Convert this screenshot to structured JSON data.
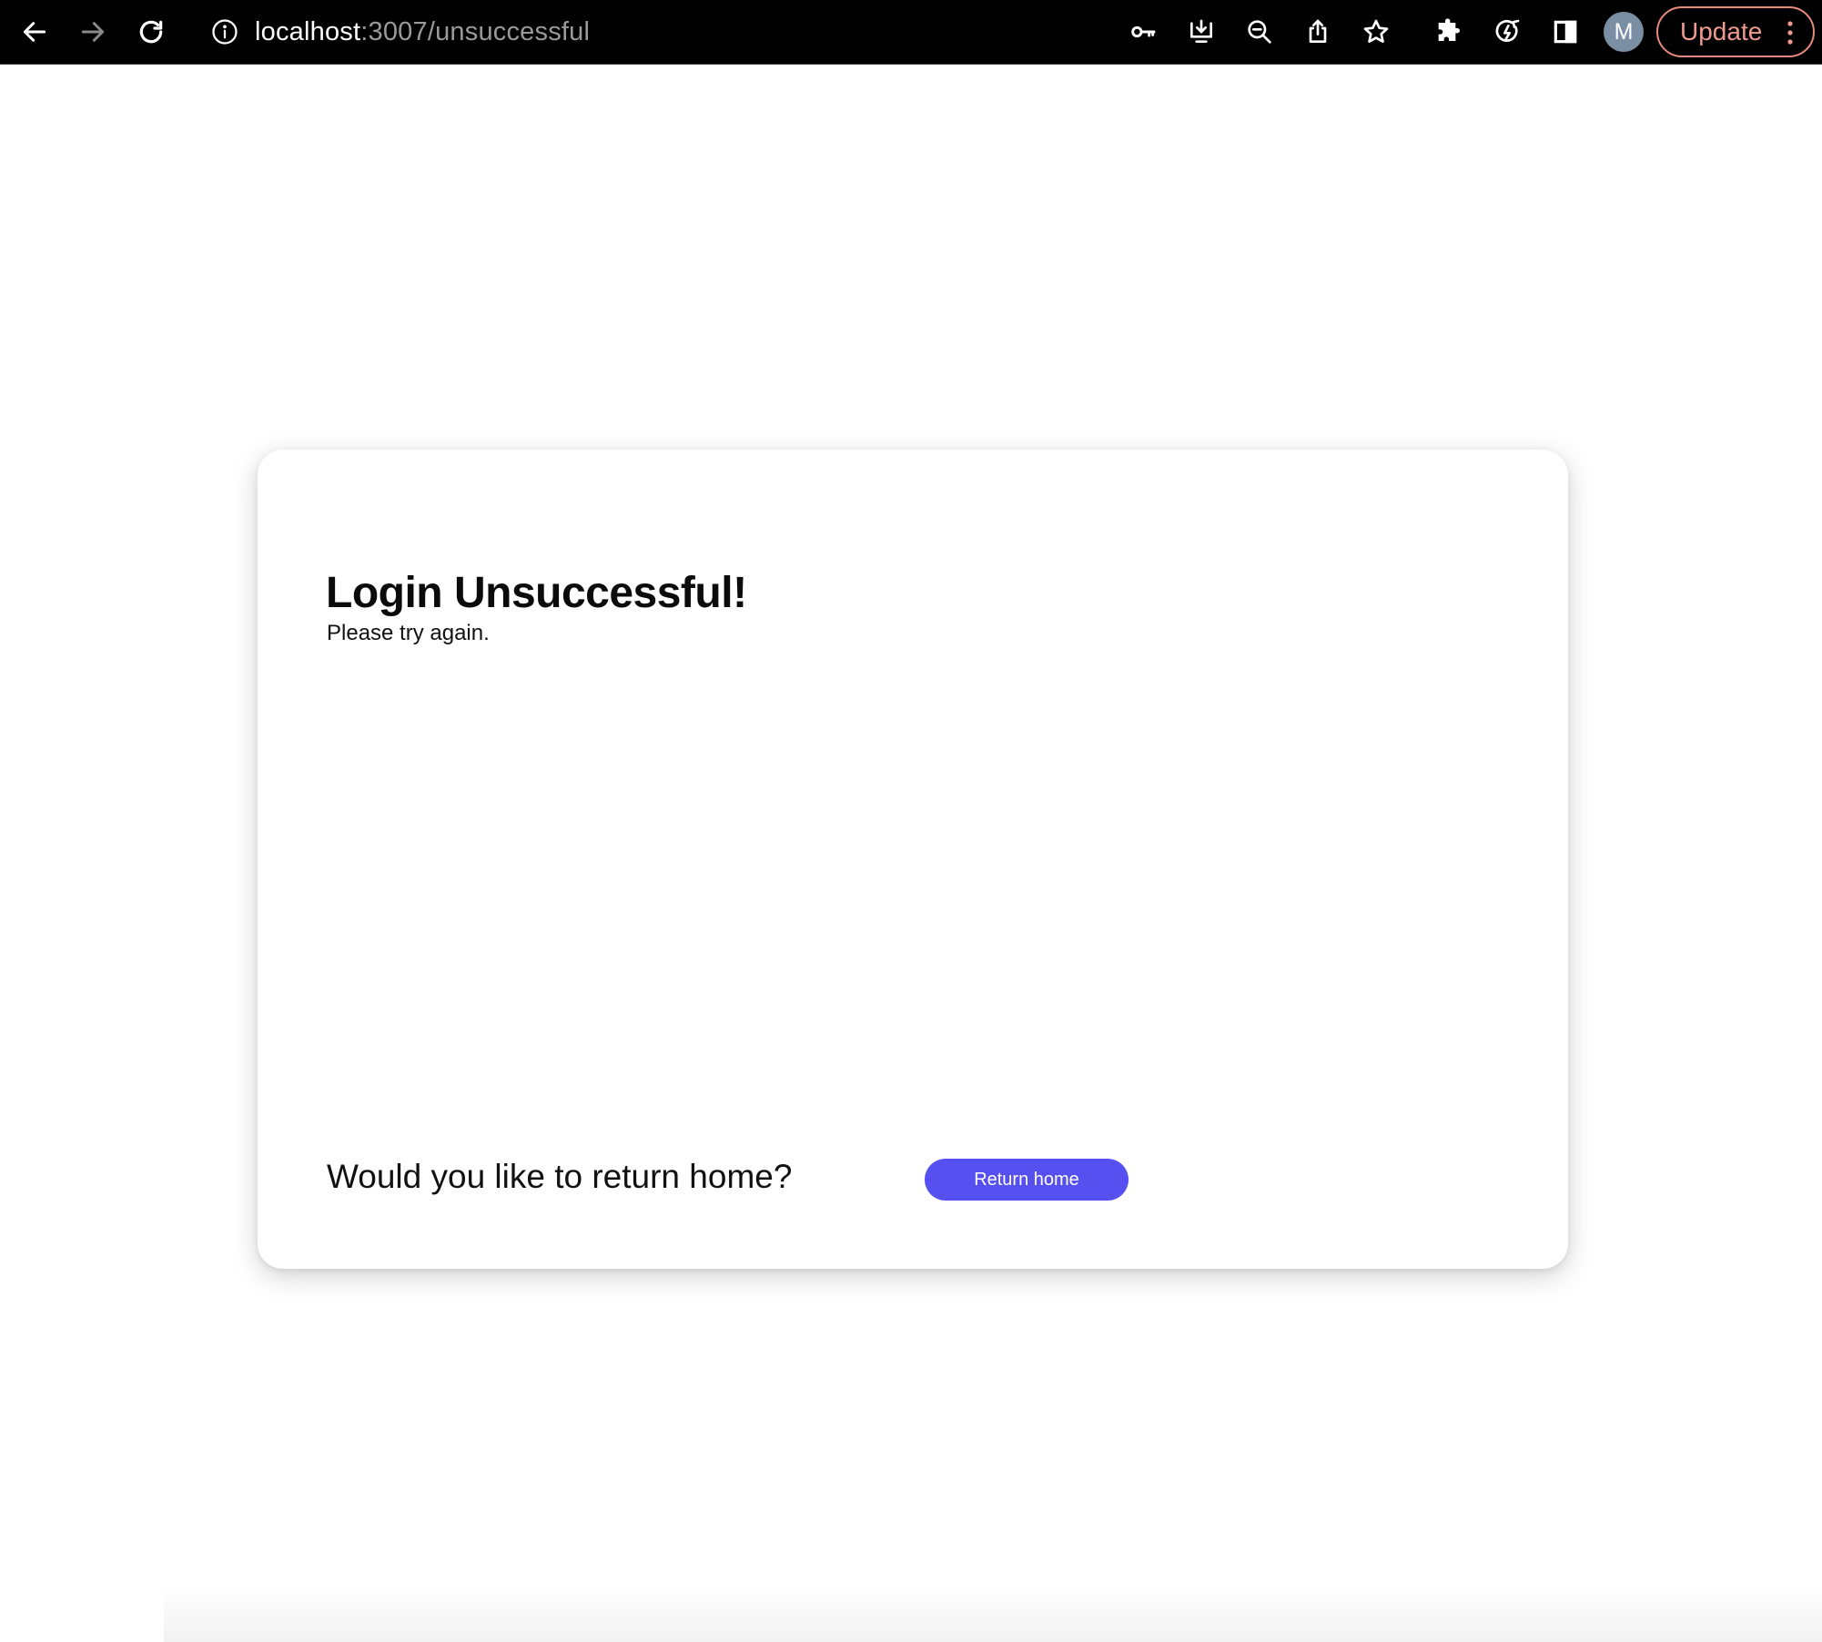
{
  "browser": {
    "url_host": "localhost",
    "url_path": ":3007/unsuccessful",
    "avatar_letter": "M",
    "update_label": "Update",
    "icons": [
      "back-arrow-icon",
      "forward-arrow-icon",
      "reload-icon",
      "site-info-icon",
      "key-icon",
      "install-icon",
      "zoom-out-icon",
      "share-icon",
      "star-icon",
      "extensions-icon",
      "performance-icon",
      "side-panel-icon",
      "more-menu-icon"
    ]
  },
  "page": {
    "title": "Login Unsuccessful!",
    "subtitle": "Please try again.",
    "return_prompt": "Would you like to return home?",
    "return_button_label": "Return home"
  },
  "colors": {
    "accent": "#5650f0",
    "toolbar_bg": "#000000",
    "update_border": "#e8897d"
  }
}
